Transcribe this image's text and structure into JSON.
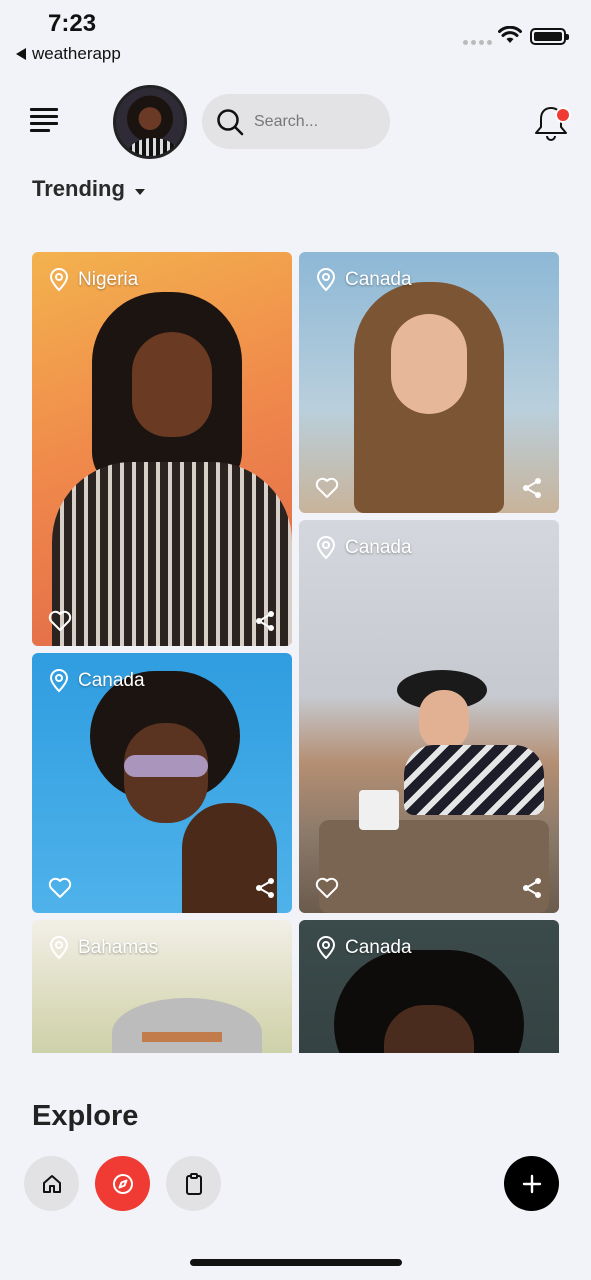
{
  "status_bar": {
    "time": "7:23",
    "back_app": "weatherapp"
  },
  "header": {
    "search": {
      "placeholder": "Search..."
    },
    "has_notification": true
  },
  "section": {
    "title": "Trending"
  },
  "cards": [
    {
      "location": "Nigeria"
    },
    {
      "location": "Canada"
    },
    {
      "location": "Canada"
    },
    {
      "location": "Canada"
    },
    {
      "location": "Bahamas"
    },
    {
      "location": "Canada"
    }
  ],
  "explore": {
    "title": "Explore"
  },
  "bottom_nav": {
    "items": [
      {
        "icon": "home-icon",
        "active": false
      },
      {
        "icon": "compass-icon",
        "active": true
      },
      {
        "icon": "clipboard-icon",
        "active": false
      }
    ],
    "add": {
      "icon": "plus-icon"
    }
  },
  "colors": {
    "accent": "#ef3b33",
    "background": "#f2f3f8",
    "dark": "#000000"
  }
}
